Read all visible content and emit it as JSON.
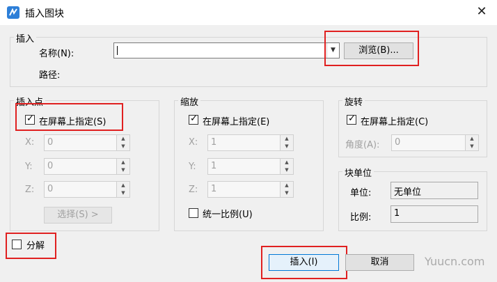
{
  "window": {
    "title": "插入图块",
    "close_symbol": "✕",
    "icon": "app-icon"
  },
  "insert_group": {
    "title": "插入",
    "name_label": "名称(N):",
    "name_value": "",
    "browse_label": "浏览(B)...",
    "path_label": "路径:"
  },
  "insertion_point": {
    "title": "插入点",
    "specify_label": "在屏幕上指定(S)",
    "specify_checked": true,
    "x_label": "X:",
    "x_value": "0",
    "y_label": "Y:",
    "y_value": "0",
    "z_label": "Z:",
    "z_value": "0",
    "select_label": "选择(S) >"
  },
  "scale": {
    "title": "缩放",
    "specify_label": "在屏幕上指定(E)",
    "specify_checked": true,
    "x_label": "X:",
    "x_value": "1",
    "y_label": "Y:",
    "y_value": "1",
    "z_label": "Z:",
    "z_value": "1",
    "uniform_label": "统一比例(U)",
    "uniform_checked": false
  },
  "rotation": {
    "title": "旋转",
    "specify_label": "在屏幕上指定(C)",
    "specify_checked": true,
    "angle_label": "角度(A):",
    "angle_value": "0"
  },
  "block_unit": {
    "title": "块单位",
    "unit_label": "单位:",
    "unit_value": "无单位",
    "ratio_label": "比例:",
    "ratio_value": "1"
  },
  "explode": {
    "label": "分解",
    "checked": false
  },
  "buttons": {
    "insert_label": "插入(I)",
    "cancel_label": "取消"
  },
  "watermark": "Yuucn.com",
  "colors": {
    "highlight": "#e02020",
    "accent": "#2d7fd8"
  }
}
